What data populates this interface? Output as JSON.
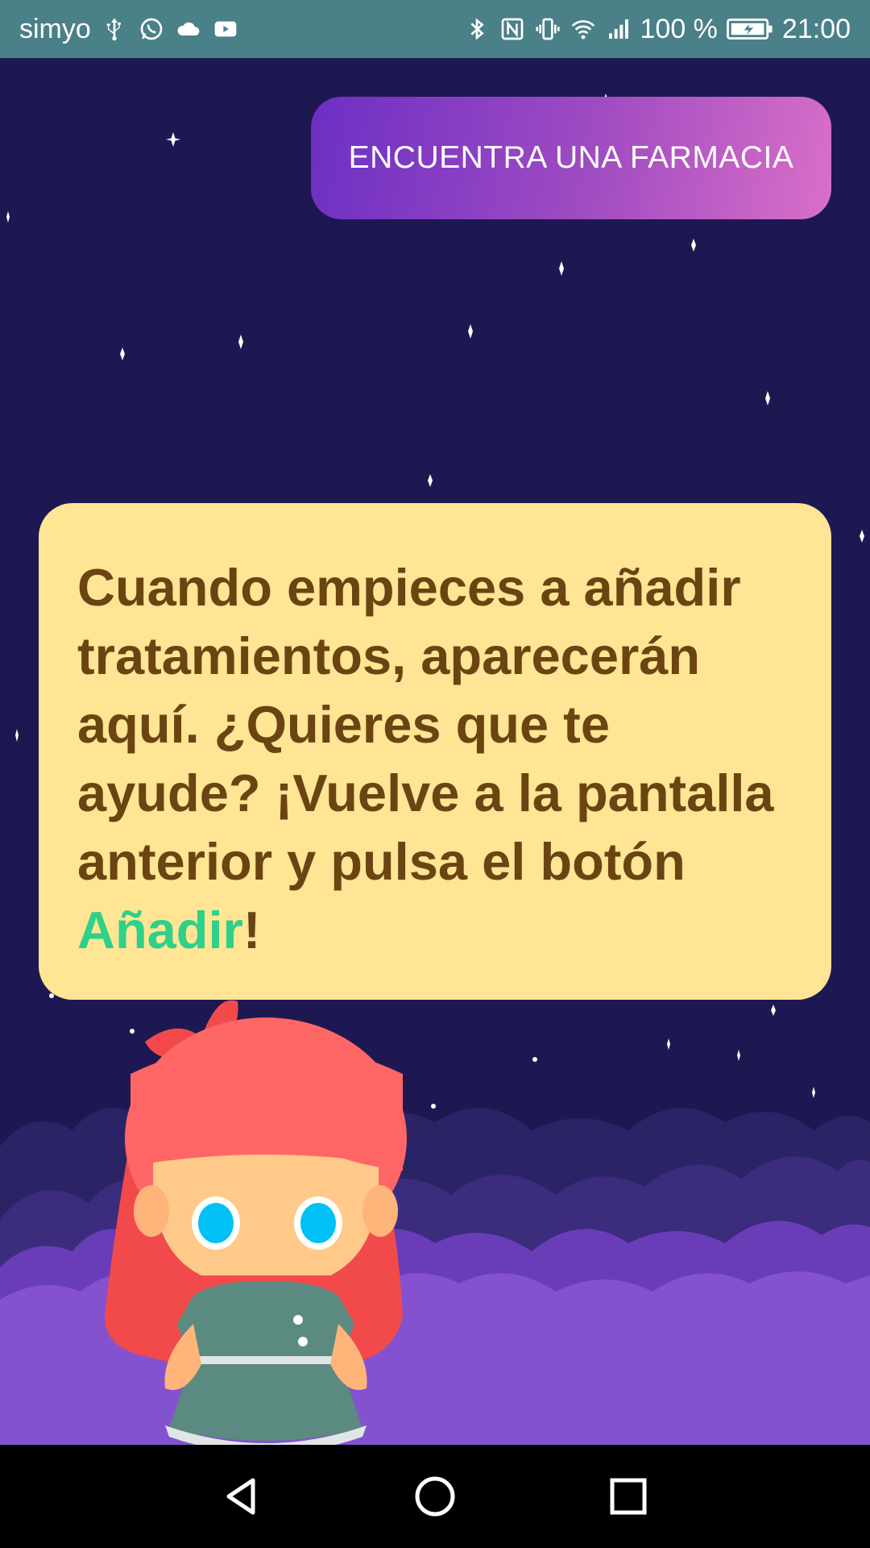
{
  "status_bar": {
    "carrier": "simyo",
    "left_icons": [
      "usb-icon",
      "whatsapp-icon",
      "cloud-icon",
      "youtube-icon"
    ],
    "right_icons": [
      "bluetooth-icon",
      "nfc-icon",
      "vibrate-icon",
      "wifi-icon",
      "signal-icon"
    ],
    "battery_percent": "100 %",
    "time": "21:00"
  },
  "main": {
    "pharmacy_button_label": "ENCUENTRA UNA FARMACIA",
    "message_prefix": "Cuando empieces a añadir tratamientos, aparecerán aquí. ¿Quieres que te ayude? ¡Vuelve a la pantalla anterior y pulsa el botón ",
    "message_highlight": "Añadir",
    "message_suffix": "!"
  },
  "nav_bar": {
    "icons": [
      "back-icon",
      "home-icon",
      "recents-icon"
    ]
  },
  "colors": {
    "status_bar": "#4a8088",
    "background": "#1e1852",
    "card": "#ffe594",
    "card_text": "#6b4412",
    "highlight": "#2ed08a",
    "button_gradient_start": "#6c2fc4",
    "button_gradient_end": "#d96fc8"
  }
}
